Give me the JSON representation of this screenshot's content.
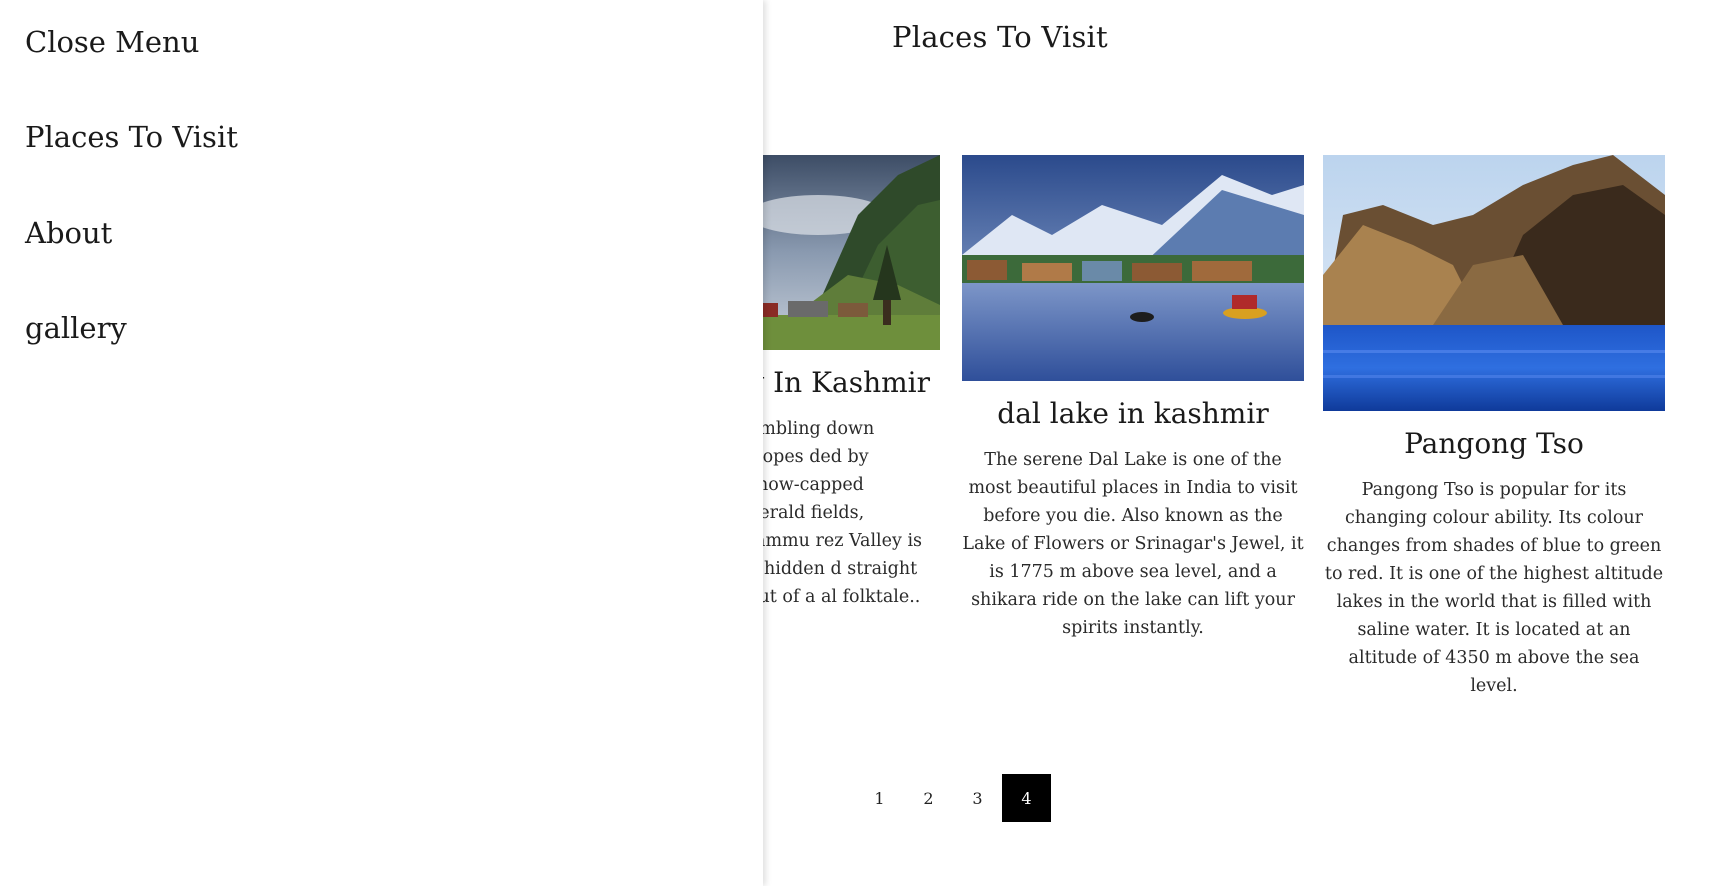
{
  "menu": {
    "close_label": "Close Menu",
    "items": [
      {
        "label": "Places To Visit"
      },
      {
        "label": "About"
      },
      {
        "label": "gallery"
      }
    ]
  },
  "main": {
    "title": "Places To Visit",
    "cards": [
      {
        "title": "y In Kashmir",
        "text": "umbling down slopes ded by snow-capped herald fields, Jammu rez Valley is a hidden d straight out of a al folktale..",
        "image": "mountain-valley-photo"
      },
      {
        "title": "dal lake in kashmir",
        "text": "The serene Dal Lake is one of the most beautiful places in India to visit before you die. Also known as the Lake of Flowers or Srinagar's Jewel, it is 1775 m above sea level, and a shikara ride on the lake can lift your spirits instantly.",
        "image": "dal-lake-photo"
      },
      {
        "title": "Pangong Tso",
        "text": "Pangong Tso is popular for its changing colour ability. Its colour changes from shades of blue to green to red. It is one of the highest altitude lakes in the world that is filled with saline water. It is located at an altitude of 4350 m above the sea level.",
        "image": "pangong-lake-photo"
      }
    ]
  },
  "pagination": {
    "pages": [
      "1",
      "2",
      "3",
      "4"
    ],
    "active": "4"
  },
  "colors": {
    "background": "#ffffff",
    "text": "#1a1a1a",
    "active_page_bg": "#000000",
    "active_page_text": "#ffffff"
  }
}
